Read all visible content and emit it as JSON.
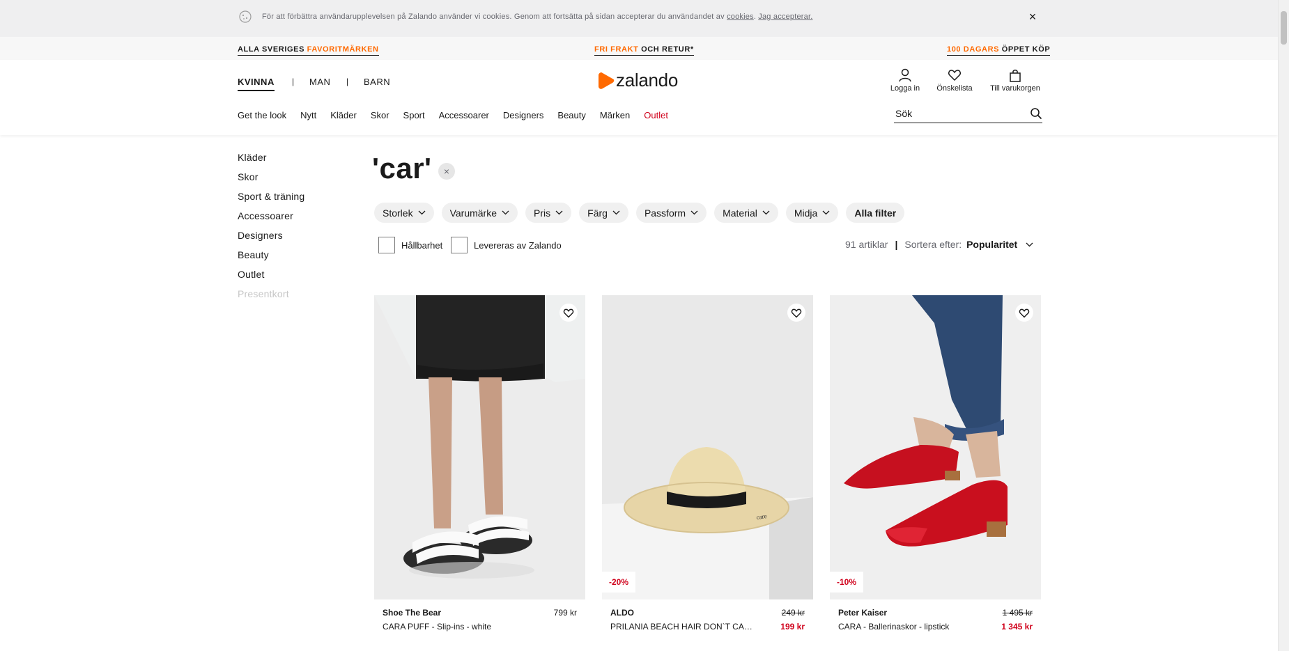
{
  "cookie": {
    "text": "För att förbättra användarupplevelsen på Zalando använder vi cookies. Genom att fortsätta på sidan accepterar du användandet av ",
    "link_cookies": "cookies",
    "link_accept": "Jag accepterar.",
    "close": "×"
  },
  "promo": {
    "left_a": "ALLA SVERIGES ",
    "left_b": "FAVORITMÄRKEN",
    "mid_a": "FRI FRAKT",
    "mid_b": " OCH RETUR*",
    "right_a": "100 DAGARS",
    "right_b": " ÖPPET KÖP"
  },
  "header": {
    "genders": [
      "KVINNA",
      "MAN",
      "BARN"
    ],
    "separator": "|",
    "logo": "zalando",
    "login": "Logga in",
    "wishlist": "Önskelista",
    "cart": "Till varukorgen",
    "search_placeholder": "Sök",
    "nav": [
      "Get the look",
      "Nytt",
      "Kläder",
      "Skor",
      "Sport",
      "Accessoarer",
      "Designers",
      "Beauty",
      "Märken",
      "Outlet"
    ]
  },
  "sidebar": {
    "items": [
      "Kläder",
      "Skor",
      "Sport & träning",
      "Accessoarer",
      "Designers",
      "Beauty",
      "Outlet",
      "Presentkort"
    ]
  },
  "search": {
    "query_title": "'car'",
    "clear": "×"
  },
  "filters": {
    "chips": [
      "Storlek",
      "Varumärke",
      "Pris",
      "Färg",
      "Passform",
      "Material",
      "Midja"
    ],
    "all": "Alla filter",
    "check_sustainability": "Hållbarhet",
    "check_zalando": "Levereras av Zalando",
    "count": "91 artiklar",
    "sep": "|",
    "sort_label": "Sortera efter:",
    "sort_value": "Popularitet"
  },
  "products": [
    {
      "brand": "Shoe The Bear",
      "name": "CARA PUFF - Slip-ins - white",
      "price": "799 kr"
    },
    {
      "brand": "ALDO",
      "name": "PRILANIA BEACH HAIR DON`T CARE - Hatt - natural",
      "old_price": "249 kr",
      "new_price": "199 kr",
      "badge": "-20%"
    },
    {
      "brand": "Peter Kaiser",
      "name": "CARA - Ballerinaskor - lipstick",
      "old_price": "1 495 kr",
      "new_price": "1 345 kr",
      "badge": "-10%"
    }
  ],
  "colors": {
    "accent": "#ff6900",
    "sale": "#d0011b",
    "text": "#1a1a1a"
  },
  "icons": {
    "cookie": "cookie-icon",
    "user": "user-icon",
    "heart": "heart-icon",
    "bag": "bag-icon",
    "search": "search-icon",
    "chevron": "chevron-down-icon",
    "close": "close-icon"
  }
}
